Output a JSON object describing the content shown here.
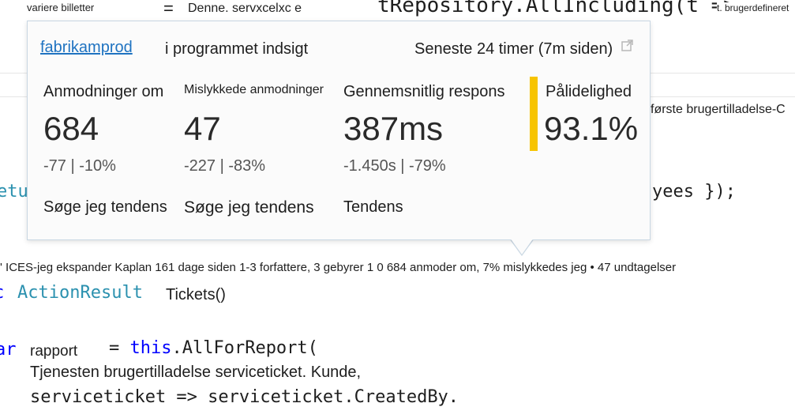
{
  "background": {
    "top_left_label": "variere billetter",
    "top_equals": "=",
    "top_label2": "Denne. servxcelxc e",
    "top_code": "tRepository.AllIncluding(t =>",
    "top_right_label": "t. brugerdefineret",
    "right_label": "første brugertilladelse-C",
    "left_code_fragment": "etu",
    "right_code_fragment": "yees });",
    "lens_line": "' ICES-jeg ekspander Kaplan 161 dage siden 1-3 forfattere, 3 gebyrer 1 0 684 anmoder om, 7% mislykkedes jeg • 47 undtagelser",
    "action_prefix": "c",
    "action_type": "ActionResult",
    "action_method": "Tickets()",
    "var_keyword": "ar",
    "var_name": "rapport",
    "assign": "= this.AllForReport(",
    "comment_line": "Tjenesten brugertilladelse serviceticket. Kunde,",
    "bottom_code": "serviceticket => serviceticket.CreatedBy."
  },
  "popup": {
    "app_name": "fabrikamprod",
    "app_suffix": "i programmet indsigt",
    "time_range": "Seneste 24 timer (7m siden)",
    "metrics": [
      {
        "title": "Anmodninger om",
        "value": "684",
        "delta": "-77 | -10%",
        "trend": "Søge jeg tendens"
      },
      {
        "title": "Mislykkede anmodninger",
        "value": "47",
        "delta": "-227 | -83%",
        "trend": "Søge jeg tendens"
      },
      {
        "title": "Gennemsnitlig respons",
        "value": "387ms",
        "delta": "-1.450s | -79%",
        "trend": "Tendens"
      },
      {
        "title": "Pålidelighed",
        "value": "93.1%"
      }
    ],
    "reliability_color": "#f7c400",
    "link_color": "#1f73c1"
  }
}
